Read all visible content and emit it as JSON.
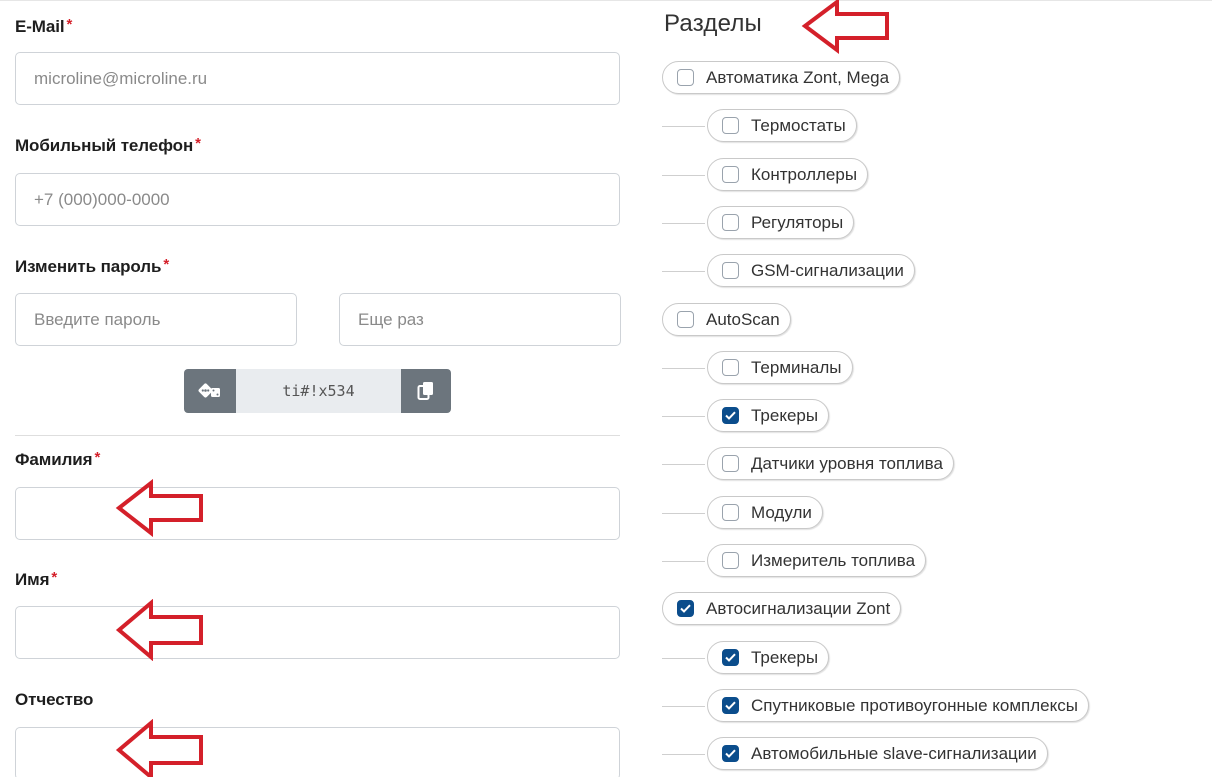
{
  "form": {
    "email": {
      "label": "E-Mail",
      "required_mark": "*",
      "placeholder": "microline@microline.ru",
      "value": ""
    },
    "phone": {
      "label": "Мобильный телефон",
      "required_mark": "*",
      "placeholder": "+7 (000)000-0000",
      "value": ""
    },
    "password": {
      "label": "Изменить пароль",
      "required_mark": "*",
      "placeholder_main": "Введите пароль",
      "placeholder_repeat": "Еще раз",
      "generated_value": "ti#!x534",
      "generate_icon": "dice-icon",
      "copy_icon": "copy-icon"
    },
    "last_name": {
      "label": "Фамилия",
      "required_mark": "*",
      "value": ""
    },
    "first_name": {
      "label": "Имя",
      "required_mark": "*",
      "value": ""
    },
    "middle_name": {
      "label": "Отчество",
      "value": ""
    }
  },
  "sections": {
    "title": "Разделы",
    "items": [
      {
        "label": "Автоматика Zont, Mega",
        "checked": false,
        "level": 0
      },
      {
        "label": "Термостаты",
        "checked": false,
        "level": 1
      },
      {
        "label": "Контроллеры",
        "checked": false,
        "level": 1
      },
      {
        "label": "Регуляторы",
        "checked": false,
        "level": 1
      },
      {
        "label": "GSM-сигнализации",
        "checked": false,
        "level": 1
      },
      {
        "label": "AutoScan",
        "checked": false,
        "level": 0
      },
      {
        "label": "Терминалы",
        "checked": false,
        "level": 1
      },
      {
        "label": "Трекеры",
        "checked": true,
        "level": 1
      },
      {
        "label": "Датчики уровня топлива",
        "checked": false,
        "level": 1
      },
      {
        "label": "Модули",
        "checked": false,
        "level": 1
      },
      {
        "label": "Измеритель топлива",
        "checked": false,
        "level": 1
      },
      {
        "label": "Автосигнализации Zont",
        "checked": true,
        "level": 0
      },
      {
        "label": "Трекеры",
        "checked": true,
        "level": 1
      },
      {
        "label": "Спутниковые противоугонные комплексы",
        "checked": true,
        "level": 1
      },
      {
        "label": "Автомобильные slave-сигнализации",
        "checked": true,
        "level": 1
      }
    ]
  },
  "colors": {
    "accent": "#0b4d8c",
    "annotation": "#d4202a",
    "required": "#d4202a"
  },
  "annotations": {
    "icon": "red-arrow-icon"
  }
}
